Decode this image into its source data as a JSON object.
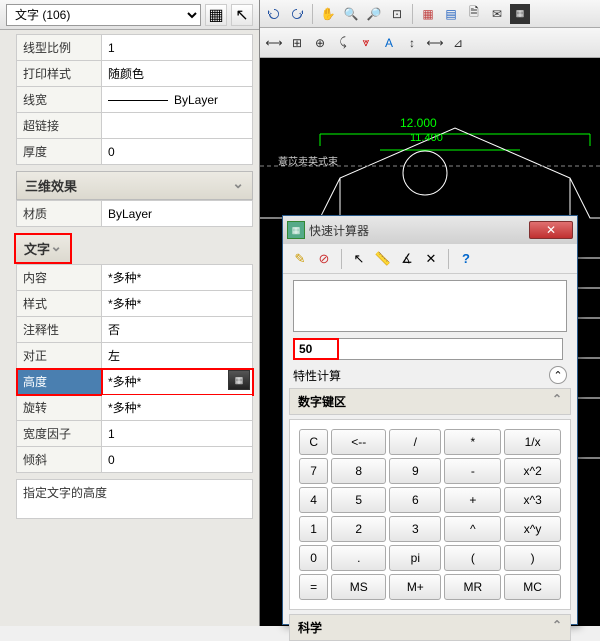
{
  "prop_dropdown": "文字 (106)",
  "rows_top": [
    {
      "label": "线型比例",
      "val": "1"
    },
    {
      "label": "打印样式",
      "val": "随颜色"
    },
    {
      "label": "线宽",
      "val": "ByLayer",
      "line": true
    },
    {
      "label": "超链接",
      "val": ""
    },
    {
      "label": "厚度",
      "val": "0"
    }
  ],
  "group_3d": "三维效果",
  "rows_3d": [
    {
      "label": "材质",
      "val": "ByLayer"
    }
  ],
  "group_text": "文字",
  "rows_text": [
    {
      "label": "内容",
      "val": "*多种*"
    },
    {
      "label": "样式",
      "val": "*多种*"
    },
    {
      "label": "注释性",
      "val": "否"
    },
    {
      "label": "对正",
      "val": "左"
    },
    {
      "label": "高度",
      "val": "*多种*",
      "hl": true,
      "calc": true
    },
    {
      "label": "旋转",
      "val": "*多种*"
    },
    {
      "label": "宽度因子",
      "val": "1"
    },
    {
      "label": "倾斜",
      "val": "0"
    }
  ],
  "hint": "指定文字的高度",
  "cad": {
    "dim1": "12.000",
    "dim2": "11.400",
    "txt1": "薏苡卖英式束"
  },
  "calc": {
    "title": "快速计算器",
    "input": "50",
    "label": "特性计算",
    "section1": "数字键区",
    "section2": "科学",
    "keys": [
      [
        "C",
        "<--",
        "/",
        "*",
        "1/x"
      ],
      [
        "7",
        "8",
        "9",
        "-",
        "x^2"
      ],
      [
        "4",
        "5",
        "6",
        "+",
        "x^3"
      ],
      [
        "1",
        "2",
        "3",
        "^",
        "x^y"
      ],
      [
        "0",
        ".",
        "pi",
        "(",
        ")"
      ],
      [
        "=",
        "MS",
        "M+",
        "MR",
        "MC"
      ]
    ]
  }
}
